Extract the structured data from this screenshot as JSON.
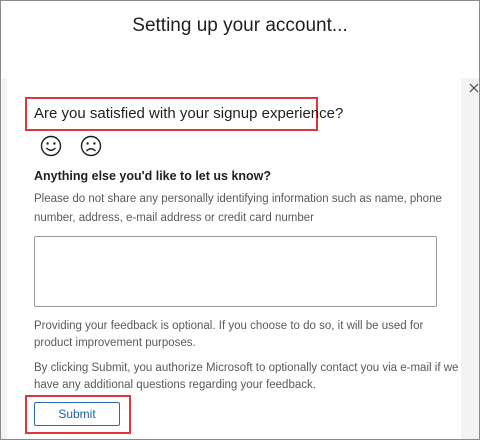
{
  "header": {
    "title": "Setting up your account..."
  },
  "survey": {
    "question": "Are you satisfied with your signup experience?",
    "faces": [
      {
        "icon": "smiley-face-icon",
        "glyph": "☺"
      },
      {
        "icon": "frowning-face-icon",
        "glyph": "☹"
      }
    ],
    "subheading": "Anything else you'd like to let us know?",
    "privacy_hint": "Please do not share any personally identifying information such as name, phone number, address, e-mail address or credit card number",
    "feedback_value": "",
    "optional_note": "Providing your feedback is optional. If you choose to do so, it will be used for product improvement purposes.",
    "consent_note": "By clicking Submit, you authorize Microsoft to optionally contact you via e-mail if we have any additional questions regarding your feedback.",
    "submit_label": "Submit"
  },
  "colors": {
    "highlight": "#e0353b",
    "accent": "#1a5fa8",
    "background": "#f3f3f3"
  }
}
